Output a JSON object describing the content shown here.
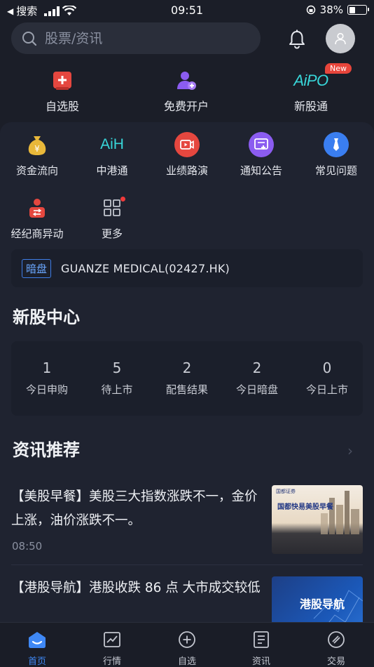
{
  "status_bar": {
    "back_label": "搜索",
    "time": "09:51",
    "battery": "38%",
    "battery_level": 0.38
  },
  "header": {
    "search_placeholder": "股票/资讯"
  },
  "quick_actions": [
    {
      "label": "自选股"
    },
    {
      "label": "免费开户"
    },
    {
      "label": "新股通",
      "icon_text": "AiPO",
      "badge": "New"
    }
  ],
  "feature_grid": [
    {
      "label": "资金流向",
      "icon": "money-bag-icon",
      "color": "#e9b83a"
    },
    {
      "label": "中港通",
      "icon_text": "AiH"
    },
    {
      "label": "业绩路演",
      "icon": "video-icon",
      "color": "#e5473f"
    },
    {
      "label": "通知公告",
      "icon": "notice-icon",
      "color": "#8b5cf0"
    },
    {
      "label": "常见问题",
      "icon": "tie-icon",
      "color": "#3a7ef0"
    },
    {
      "label": "经纪商异动",
      "icon": "broker-icon",
      "color": "#e5473f"
    },
    {
      "label": "更多",
      "icon": "grid-icon"
    }
  ],
  "dark_pool": {
    "tag": "暗盘",
    "text": "GUANZE MEDICAL(02427.HK)"
  },
  "ipo_center": {
    "title": "新股中心",
    "stats": [
      {
        "value": "1",
        "label": "今日申购"
      },
      {
        "value": "5",
        "label": "待上市"
      },
      {
        "value": "2",
        "label": "配售结果"
      },
      {
        "value": "2",
        "label": "今日暗盘"
      },
      {
        "value": "0",
        "label": "今日上市"
      }
    ]
  },
  "news": {
    "title": "资讯推荐",
    "items": [
      {
        "title": "【美股早餐】美股三大指数涨跌不一，金价上涨，油价涨跌不一。",
        "time": "08:50",
        "thumb_brand": "国都证券",
        "thumb_caption": "国都快易美股早餐"
      },
      {
        "title": "【港股导航】港股收跌 86 点 大市成交较低",
        "time": "",
        "thumb_caption": "港股导航"
      }
    ]
  },
  "tabs": [
    {
      "label": "首页",
      "active": true
    },
    {
      "label": "行情"
    },
    {
      "label": "自选"
    },
    {
      "label": "资讯"
    },
    {
      "label": "交易"
    }
  ],
  "colors": {
    "accent": "#3f88f5",
    "background": "#1b1e28",
    "panel": "#1f2330"
  }
}
